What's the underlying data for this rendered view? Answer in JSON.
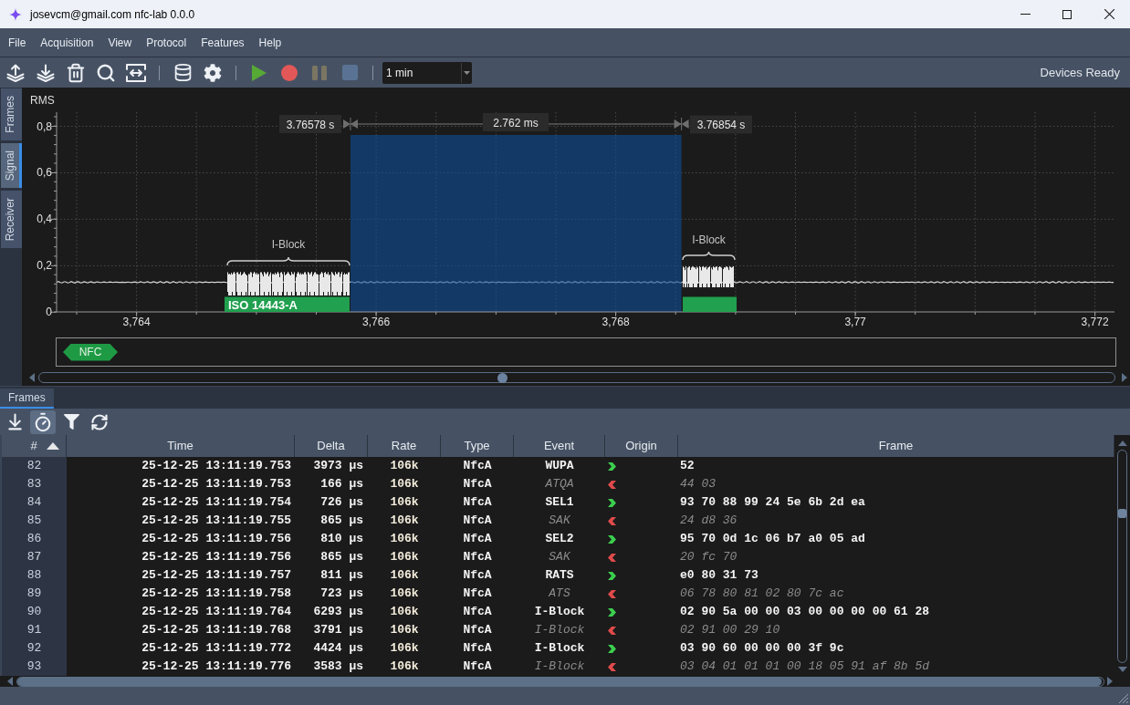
{
  "window": {
    "title": "josevcm@gmail.com nfc-lab 0.0.0"
  },
  "menu": [
    "File",
    "Acquisition",
    "View",
    "Protocol",
    "Features",
    "Help"
  ],
  "toolbar": {
    "playback": [
      {
        "kind": "play",
        "disabled": false
      },
      {
        "kind": "record",
        "disabled": false
      },
      {
        "kind": "pause",
        "disabled": true
      },
      {
        "kind": "stop",
        "disabled": true
      }
    ],
    "duration": {
      "value": "1 min"
    },
    "status": "Devices Ready"
  },
  "side_tabs": [
    {
      "label": "Frames",
      "selected": false
    },
    {
      "label": "Signal",
      "selected": true
    },
    {
      "label": "Receiver",
      "selected": false
    }
  ],
  "signal_view": {
    "y_label": "RMS",
    "y_ticks": [
      "0,8",
      "0,6",
      "0,4",
      "0,2",
      "0"
    ],
    "x_ticks": [
      "3,764",
      "3,766",
      "3,768",
      "3,77",
      "3,772"
    ],
    "selection": {
      "start": "3.76578 s",
      "duration": "2.762 ms",
      "end": "3.76854 s"
    },
    "frames": [
      {
        "label": "I-Block",
        "protocol": "ISO 14443-A"
      },
      {
        "label": "I-Block"
      }
    ],
    "lanes": [
      {
        "label": "NFC"
      }
    ]
  },
  "dock_tabs": [
    {
      "label": "Frames",
      "selected": true
    }
  ],
  "frames_toolbar": [
    {
      "kind": "download",
      "on": false
    },
    {
      "kind": "stopwatch",
      "on": true
    },
    {
      "kind": "filter",
      "on": false
    },
    {
      "kind": "refresh",
      "on": false
    }
  ],
  "table": {
    "columns": [
      {
        "label": "#",
        "sorted": true
      },
      {
        "label": "Time",
        "sorted": false
      },
      {
        "label": "Delta",
        "sorted": false
      },
      {
        "label": "Rate",
        "sorted": false
      },
      {
        "label": "Type",
        "sorted": false
      },
      {
        "label": "Event",
        "sorted": false
      },
      {
        "label": "Origin",
        "sorted": false
      },
      {
        "label": "Frame",
        "sorted": false
      }
    ],
    "rows": [
      {
        "number": "82",
        "time": "25-12-25 13:11:19.753",
        "delta": "3973 µs",
        "rate": "106k",
        "type": "NfcA",
        "event": "WUPA",
        "kind": "outgoing",
        "frame": "52"
      },
      {
        "number": "83",
        "time": "25-12-25 13:11:19.753",
        "delta": "166 µs",
        "rate": "106k",
        "type": "NfcA",
        "event": "ATQA",
        "kind": "incoming",
        "frame": "44 03"
      },
      {
        "number": "84",
        "time": "25-12-25 13:11:19.754",
        "delta": "726 µs",
        "rate": "106k",
        "type": "NfcA",
        "event": "SEL1",
        "kind": "outgoing",
        "frame": "93 70 88 99 24 5e 6b 2d ea"
      },
      {
        "number": "85",
        "time": "25-12-25 13:11:19.755",
        "delta": "865 µs",
        "rate": "106k",
        "type": "NfcA",
        "event": "SAK",
        "kind": "incoming",
        "frame": "24 d8 36"
      },
      {
        "number": "86",
        "time": "25-12-25 13:11:19.756",
        "delta": "810 µs",
        "rate": "106k",
        "type": "NfcA",
        "event": "SEL2",
        "kind": "outgoing",
        "frame": "95 70 0d 1c 06 b7 a0 05 ad"
      },
      {
        "number": "87",
        "time": "25-12-25 13:11:19.756",
        "delta": "865 µs",
        "rate": "106k",
        "type": "NfcA",
        "event": "SAK",
        "kind": "incoming",
        "frame": "20 fc 70"
      },
      {
        "number": "88",
        "time": "25-12-25 13:11:19.757",
        "delta": "811 µs",
        "rate": "106k",
        "type": "NfcA",
        "event": "RATS",
        "kind": "outgoing",
        "frame": "e0 80 31 73"
      },
      {
        "number": "89",
        "time": "25-12-25 13:11:19.758",
        "delta": "723 µs",
        "rate": "106k",
        "type": "NfcA",
        "event": "ATS",
        "kind": "incoming",
        "frame": "06 78 80 81 02 80 7c ac"
      },
      {
        "number": "90",
        "time": "25-12-25 13:11:19.764",
        "delta": "6293 µs",
        "rate": "106k",
        "type": "NfcA",
        "event": "I-Block",
        "kind": "outgoing",
        "frame": "02 90 5a 00 00 03 00 00 00 00 61 28"
      },
      {
        "number": "91",
        "time": "25-12-25 13:11:19.768",
        "delta": "3791 µs",
        "rate": "106k",
        "type": "NfcA",
        "event": "I-Block",
        "kind": "incoming",
        "frame": "02 91 00 29 10"
      },
      {
        "number": "92",
        "time": "25-12-25 13:11:19.772",
        "delta": "4424 µs",
        "rate": "106k",
        "type": "NfcA",
        "event": "I-Block",
        "kind": "outgoing",
        "frame": "03 90 60 00 00 00 3f 9c"
      },
      {
        "number": "93",
        "time": "25-12-25 13:11:19.776",
        "delta": "3583 µs",
        "rate": "106k",
        "type": "NfcA",
        "event": "I-Block",
        "kind": "incoming",
        "frame": "03 04 01 01 01 00 18 05 91 af 8b 5d"
      }
    ]
  }
}
